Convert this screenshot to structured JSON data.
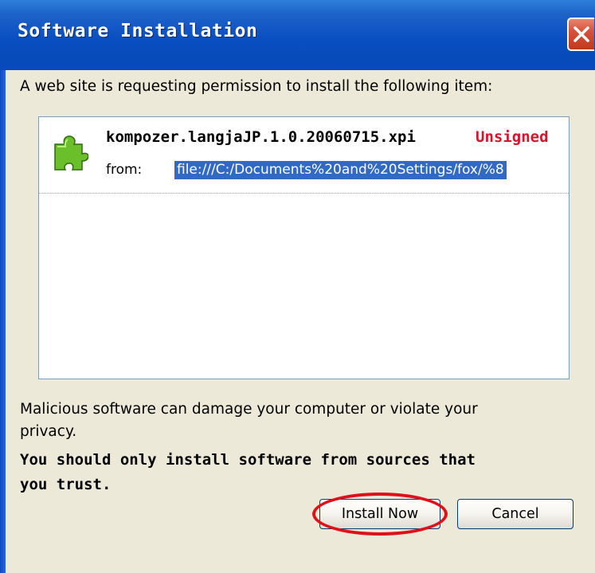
{
  "window": {
    "title": "Software Installation"
  },
  "prompt": "A web site is requesting permission to install the following item:",
  "item": {
    "name": "kompozer.langjaJP.1.0.20060715.xpi",
    "status": "Unsigned",
    "from_label": "from:",
    "url": "file:///C:/Documents%20and%20Settings/fox/%8"
  },
  "warning": {
    "line1": "Malicious software can damage your computer or violate your",
    "line2": "privacy.",
    "bold_line1": "You should only install software from sources that",
    "bold_line2": "you trust."
  },
  "buttons": {
    "install": "Install Now",
    "cancel": "Cancel"
  },
  "colors": {
    "titlebar": "#0a4fc2",
    "unsigned": "#d4162c",
    "selection": "#316ac5",
    "annotation_ring": "#e0101a"
  }
}
